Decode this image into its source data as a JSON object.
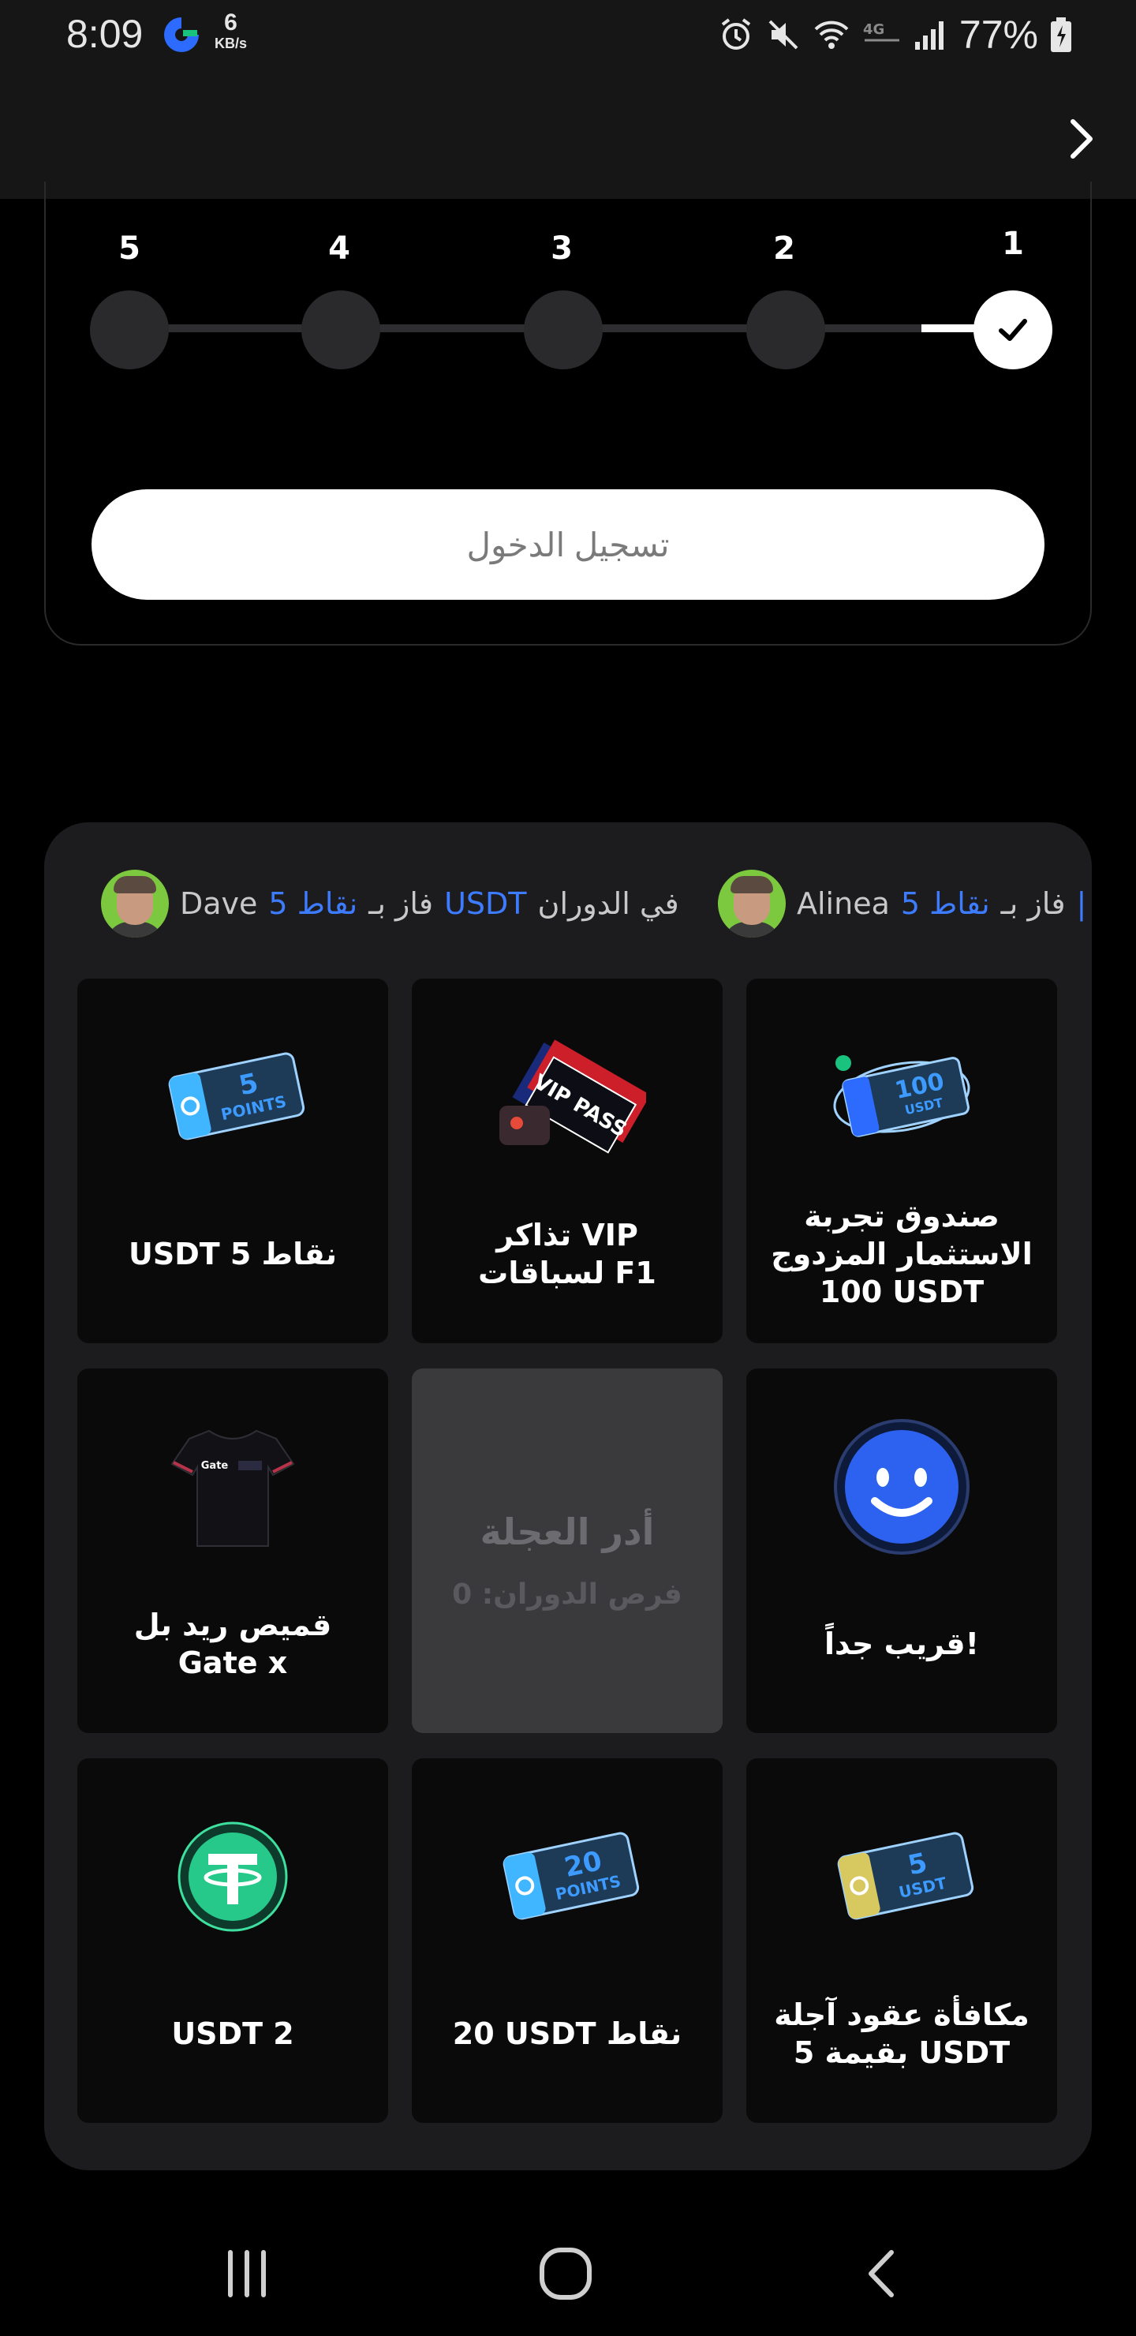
{
  "status_bar": {
    "time": "8:09",
    "speed_value": "6",
    "speed_unit": "KB/s",
    "battery": "77%",
    "icons": [
      "g-app-icon",
      "alarm-icon",
      "mute-icon",
      "wifi-icon",
      "volte-icon",
      "signal-icon",
      "battery-icon"
    ]
  },
  "header": {
    "next_icon": "chevron-right-icon"
  },
  "steps": {
    "numbers": [
      "5",
      "4",
      "3",
      "2",
      "1"
    ],
    "completed": 1,
    "login_label": "تسجيل الدخول"
  },
  "ticker": [
    {
      "name": "Dave",
      "won": "فاز بـ",
      "amount": "5 نقاط",
      "currency": "USDT",
      "suffix": "في الدوران"
    },
    {
      "name": "Alinea",
      "won": "فاز بـ",
      "amount": "5 نقاط",
      "currency": "",
      "suffix": ""
    }
  ],
  "prizes": {
    "top_left": {
      "label": "USDT 5 نقاط",
      "badge_big": "5",
      "badge_small": "POINTS",
      "icon": "points-ticket-icon"
    },
    "top_middle": {
      "label": "تذاكر VIP لسباقات F1",
      "badge": "VIP PASS",
      "icon": "f1-vip-pass-icon"
    },
    "top_right": {
      "label": "صندوق تجربة الاستثمار المزدوج 100 USDT",
      "badge_big": "100",
      "badge_small": "USDT",
      "icon": "dual-investment-ticket-icon"
    },
    "mid_left": {
      "label": "قميص ريد بل Gate x",
      "shirt_text": "Gate",
      "icon": "tshirt-icon"
    },
    "center": {
      "title": "أدر العجلة",
      "subtitle": "فرص الدوران: 0"
    },
    "mid_right": {
      "label": "قريب جداً!",
      "icon": "smiley-icon"
    },
    "bottom_left": {
      "label": "USDT 2",
      "icon": "tether-coin-icon"
    },
    "bottom_middle": {
      "label": "20 USDT نقاط",
      "badge_big": "20",
      "badge_small": "POINTS",
      "icon": "points-ticket-icon"
    },
    "bottom_right": {
      "label": "مكافأة عقود آجلة بقيمة 5 USDT",
      "badge_big": "5",
      "badge_small": "USDT",
      "icon": "futures-ticket-icon"
    }
  },
  "nav": {
    "recents_icon": "recents-icon",
    "home_icon": "home-icon",
    "back_icon": "back-icon"
  }
}
